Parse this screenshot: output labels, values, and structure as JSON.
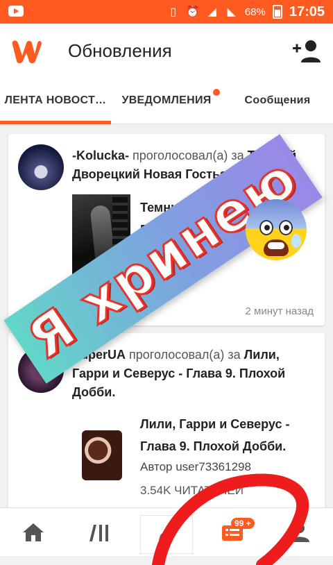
{
  "status_bar": {
    "battery": "68%",
    "time": "17:05"
  },
  "app_bar": {
    "title": "Обновления"
  },
  "tabs": [
    {
      "label": "ЛЕНТА НОВОСТ…",
      "active": true
    },
    {
      "label": "УВЕДОМЛЕНИЯ",
      "has_dot": true
    },
    {
      "label": "Сообщения"
    }
  ],
  "feed": [
    {
      "username": "-Kolucka-",
      "action": "проголосовал(а) за",
      "story": "Темный Дворецкий Новая Гостья Глава",
      "card_title": "Темный Дворецкий Новая Гостья",
      "timestamp": "2 минут назад"
    },
    {
      "username": "SuperUA",
      "action": "проголосовал(а) за",
      "story": "Лили, Гарри и Северус - Глава 9. Плохой Добби.",
      "card_title": "Лили, Гарри и Северус - Глава 9. Плохой Добби.",
      "author": "Автор user73361298",
      "readers": "3.54K ЧИТАТЕЛЕЙ"
    }
  ],
  "bottom_nav": {
    "badge": "99 +"
  },
  "overlay": {
    "sticker_text": "Я хринею"
  }
}
